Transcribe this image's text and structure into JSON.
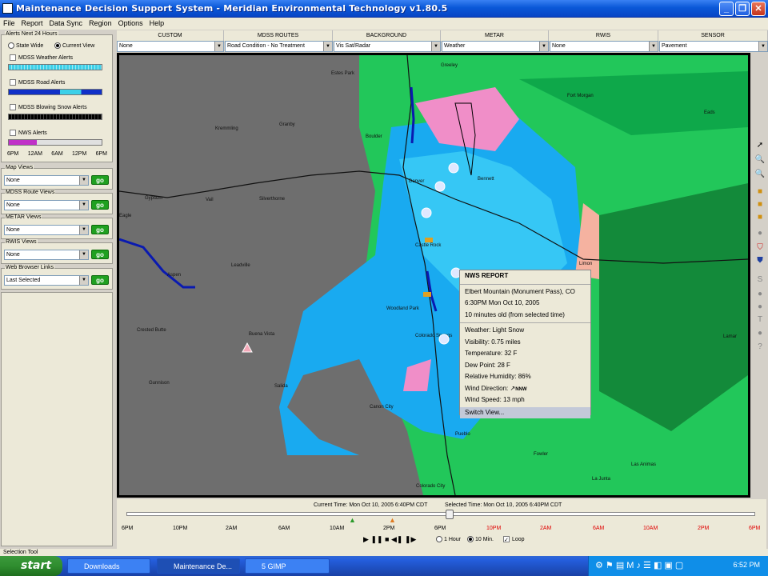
{
  "window": {
    "title": "Maintenance Decision Support System - Meridian Environmental Technology v1.80.5"
  },
  "menu": [
    "File",
    "Report",
    "Data Sync",
    "Region",
    "Options",
    "Help"
  ],
  "alerts": {
    "legend": "Alerts Next 24 Hours",
    "scope_options": [
      "State Wide",
      "Current View"
    ],
    "scope_selected": "Current View",
    "rows": [
      {
        "label": "MDSS Weather Alerts",
        "color": "#3cd0e8"
      },
      {
        "label": "MDSS Road Alerts",
        "color": "#1030c8"
      },
      {
        "label": "MDSS Blowing Snow Alerts",
        "color": "#000000"
      },
      {
        "label": "NWS Alerts",
        "color": "#c030c8"
      }
    ],
    "time_labels": [
      "6PM",
      "12AM",
      "6AM",
      "12PM",
      "6PM"
    ]
  },
  "views": [
    {
      "legend": "Map Views",
      "value": "None"
    },
    {
      "legend": "MDSS Route Views",
      "value": "None"
    },
    {
      "legend": "METAR Views",
      "value": "None"
    },
    {
      "legend": "RWIS Views",
      "value": "None"
    },
    {
      "legend": "Web Browser Links",
      "value": "Last Selected"
    }
  ],
  "go_label": "go",
  "layers": [
    {
      "header": "CUSTOM",
      "value": "None"
    },
    {
      "header": "MDSS ROUTES",
      "value": "Road Condition - No Treatment"
    },
    {
      "header": "BACKGROUND",
      "value": "Vis Sat/Radar"
    },
    {
      "header": "METAR",
      "value": "Weather"
    },
    {
      "header": "RWIS",
      "value": "None"
    },
    {
      "header": "SENSOR",
      "value": "Pavement"
    }
  ],
  "map": {
    "towns": [
      "Estes Park",
      "Greeley",
      "Fort Morgan",
      "Kremmling",
      "Granby",
      "Boulder",
      "Denver",
      "Bennett",
      "Gypsum",
      "Vail",
      "Silverthorne",
      "Eagle",
      "Castle Rock",
      "Limon",
      "Leadville",
      "Aspen",
      "Woodland Park",
      "Colorado Springs",
      "Crested Butte",
      "Buena Vista",
      "Salida",
      "Gunnison",
      "Canon City",
      "Pueblo",
      "Fowler",
      "La Junta",
      "Las Animas",
      "Colorado City",
      "Lamar",
      "Eads"
    ]
  },
  "popup": {
    "heading": "NWS REPORT",
    "station": "Elbert Mountain (Monument Pass), CO",
    "time": "6:30PM Mon Oct 10, 2005",
    "age": "10 minutes old (from selected time)",
    "weather": "Weather: Light Snow",
    "visibility": "Visibility: 0.75 miles",
    "temperature": "Temperature: 32 F",
    "dew_point": "Dew Point: 28 F",
    "humidity": "Relative Humidity: 86%",
    "wind_direction_label": "Wind Direction:",
    "wind_direction": "NNW",
    "wind_speed": "Wind Speed: 13 mph",
    "switch_view": "Switch View..."
  },
  "timeline": {
    "current": "Current Time: Mon Oct 10, 2005 6:40PM CDT",
    "selected": "Selected Time: Mon Oct 10, 2005 6:40PM CDT",
    "ticks": [
      "6PM",
      "10PM",
      "2AM",
      "6AM",
      "10AM",
      "2PM",
      "6PM",
      "10PM",
      "2AM",
      "6AM",
      "10AM",
      "2PM",
      "6PM"
    ],
    "past_color": "#000000",
    "future_color": "#e00000",
    "step_options": [
      "1 Hour",
      "10 Min."
    ],
    "step_selected": "10 Min.",
    "loop_label": "Loop"
  },
  "status": "Selection Tool",
  "taskbar": {
    "start": "start",
    "tasks": [
      "Downloads",
      "Maintenance De...",
      "5 GIMP"
    ],
    "clock": "6:52 PM"
  }
}
